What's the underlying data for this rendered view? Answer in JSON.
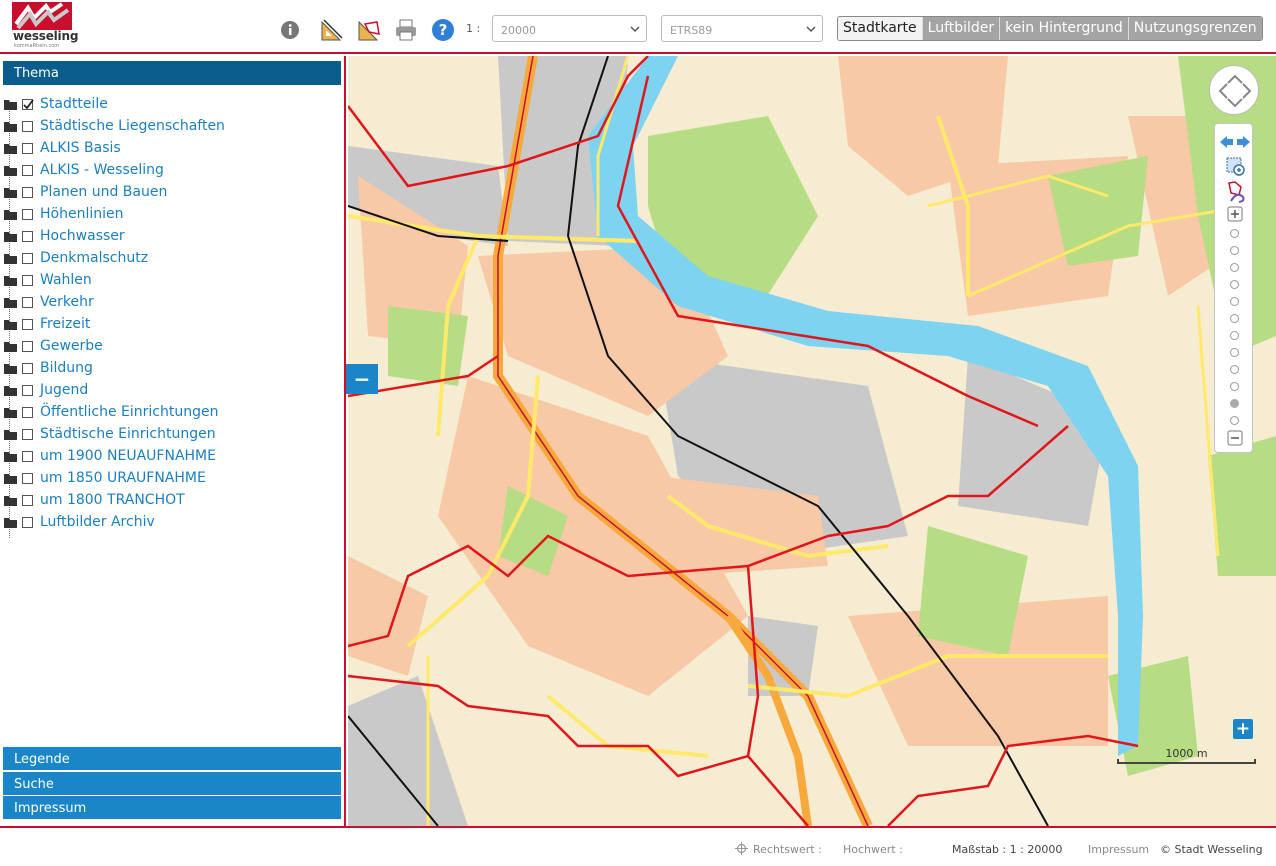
{
  "header": {
    "logo": {
      "brand": "wesseling",
      "sub": "kommaRhein.com"
    },
    "tools": [
      {
        "name": "info-icon"
      },
      {
        "name": "measure-distance-icon"
      },
      {
        "name": "measure-area-icon"
      },
      {
        "name": "print-icon"
      },
      {
        "name": "help-icon"
      }
    ],
    "scale_prefix": "1 :",
    "scale_select": {
      "value": "20000"
    },
    "crs_select": {
      "value": "ETRS89"
    },
    "background_buttons": [
      {
        "label": "Stadtkarte",
        "active": true
      },
      {
        "label": "Luftbilder",
        "active": false
      },
      {
        "label": "kein Hintergrund",
        "active": false
      },
      {
        "label": "Nutzungsgrenzen",
        "active": false
      }
    ]
  },
  "sidebar": {
    "thema_title": "Thema",
    "layers": [
      {
        "label": "Stadtteile",
        "checked": true
      },
      {
        "label": "Städtische Liegenschaften",
        "checked": false
      },
      {
        "label": "ALKIS Basis",
        "checked": false
      },
      {
        "label": "ALKIS - Wesseling",
        "checked": false
      },
      {
        "label": "Planen und Bauen",
        "checked": false
      },
      {
        "label": "Höhenlinien",
        "checked": false
      },
      {
        "label": "Hochwasser",
        "checked": false
      },
      {
        "label": "Denkmalschutz",
        "checked": false
      },
      {
        "label": "Wahlen",
        "checked": false
      },
      {
        "label": "Verkehr",
        "checked": false
      },
      {
        "label": "Freizeit",
        "checked": false
      },
      {
        "label": "Gewerbe",
        "checked": false
      },
      {
        "label": "Bildung",
        "checked": false
      },
      {
        "label": "Jugend",
        "checked": false
      },
      {
        "label": "Öffentliche Einrichtungen",
        "checked": false
      },
      {
        "label": "Städtische Einrichtungen",
        "checked": false
      },
      {
        "label": "um 1900 NEUAUFNAHME",
        "checked": false
      },
      {
        "label": "um 1850 URAUFNAHME",
        "checked": false
      },
      {
        "label": "um 1800 TRANCHOT",
        "checked": false
      },
      {
        "label": "Luftbilder Archiv",
        "checked": false
      }
    ],
    "accordion": [
      "Legende",
      "Suche",
      "Impressum"
    ]
  },
  "map": {
    "collapse_label": "−",
    "expand_label": "+",
    "scalebar_label": "1000 m",
    "zoom_levels": 12,
    "zoom_active_level": 10,
    "colors": {
      "water": "#7dd3f0",
      "residential": "#f7c9a6",
      "green": "#b6dc84",
      "industrial": "#c9c9c9",
      "background": "#f6ecd1",
      "major_road": "#f7a93b",
      "road": "#ffe96b",
      "boundary": "#e0161b",
      "rail": "#111111"
    }
  },
  "footer": {
    "rechtswert_label": "Rechtswert :",
    "hochwert_label": "Hochwert :",
    "massstab": "Maßstab : 1 : 20000",
    "impressum": "Impressum",
    "copyright": "© Stadt Wesseling"
  }
}
